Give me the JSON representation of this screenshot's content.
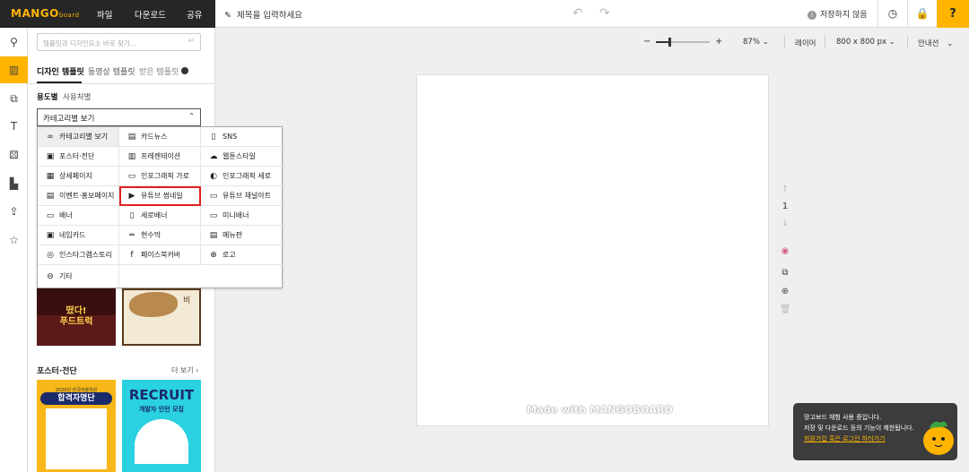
{
  "app": {
    "logo_main": "MANGO",
    "logo_sub": "board",
    "menu": [
      "파일",
      "다운로드",
      "공유"
    ],
    "title_placeholder": "제목을 입력하세요",
    "save_status": "저장하지 않음",
    "help_label": "?"
  },
  "left_rail": {
    "items": [
      "search-icon",
      "template-icon",
      "photo-icon",
      "text-icon",
      "element-icon",
      "chart-icon",
      "upload-icon",
      "favorite-icon"
    ],
    "active_index": 1
  },
  "panel": {
    "search_placeholder": "템플릿과 디자인요소 바로 찾기...",
    "tabs": [
      "디자인 템플릿",
      "동영상 템플릿",
      "받은 템플릿"
    ],
    "subtabs": [
      "용도별",
      "사용처별"
    ],
    "select_value": "카테고리별 보기",
    "section_title": "포스터·전단",
    "section_more": "더 보기 ›"
  },
  "dropdown": {
    "items": [
      {
        "label": "카테고리별 보기",
        "icon": "∞"
      },
      {
        "label": "카드뉴스",
        "icon": "▤"
      },
      {
        "label": "SNS",
        "icon": "▯"
      },
      {
        "label": "포스터·전단",
        "icon": "▣"
      },
      {
        "label": "프레젠테이션",
        "icon": "▥"
      },
      {
        "label": "웹툰스타일",
        "icon": "☁"
      },
      {
        "label": "상세페이지",
        "icon": "▦"
      },
      {
        "label": "인포그래픽 가로",
        "icon": "▭"
      },
      {
        "label": "인포그래픽 세로",
        "icon": "◐"
      },
      {
        "label": "이벤트·홍보페이지",
        "icon": "▤"
      },
      {
        "label": "유튜브 썸네일",
        "icon": "▶"
      },
      {
        "label": "유튜브 채널아트",
        "icon": "▭"
      },
      {
        "label": "배너",
        "icon": "▭"
      },
      {
        "label": "세로배너",
        "icon": "▯"
      },
      {
        "label": "미니배너",
        "icon": "▭"
      },
      {
        "label": "네임카드",
        "icon": "▣"
      },
      {
        "label": "현수막",
        "icon": "═"
      },
      {
        "label": "메뉴판",
        "icon": "▤"
      },
      {
        "label": "인스타그램스토리",
        "icon": "◎"
      },
      {
        "label": "페이스북커버",
        "icon": "f"
      },
      {
        "label": "로고",
        "icon": "⊕"
      },
      {
        "label": "기타",
        "icon": "⊖"
      }
    ],
    "highlighted_index": 10
  },
  "thumbnails": {
    "food_truck_text": "떴다!\n푸드트럭",
    "poster_right_text": "비",
    "pass_list_title": "합격자명단",
    "pass_list_sub": "2020년 한국미술학원",
    "recruit_title": "RECRUIT",
    "recruit_sub": "개발자 인턴 모집"
  },
  "canvas_toolbar": {
    "zoom_minus": "−",
    "zoom_plus": "+",
    "zoom_level": "87%",
    "zoom_fraction": 0.27,
    "layer_label": "레이어",
    "size_label": "800 x 800 px",
    "guide_label": "안내선"
  },
  "canvas": {
    "watermark": "Made with MANGOBOARD",
    "page_number": "1"
  },
  "toast": {
    "line1": "망고보드 체험 사용 중입니다.",
    "line2": "저장 및 다운로드 등의 기능이 제한됩니다.",
    "link": "회원가입 혹은 로그인 하러가기"
  },
  "colors": {
    "accent": "#ffb400",
    "topbar": "#262626",
    "highlight": "#e02020"
  }
}
